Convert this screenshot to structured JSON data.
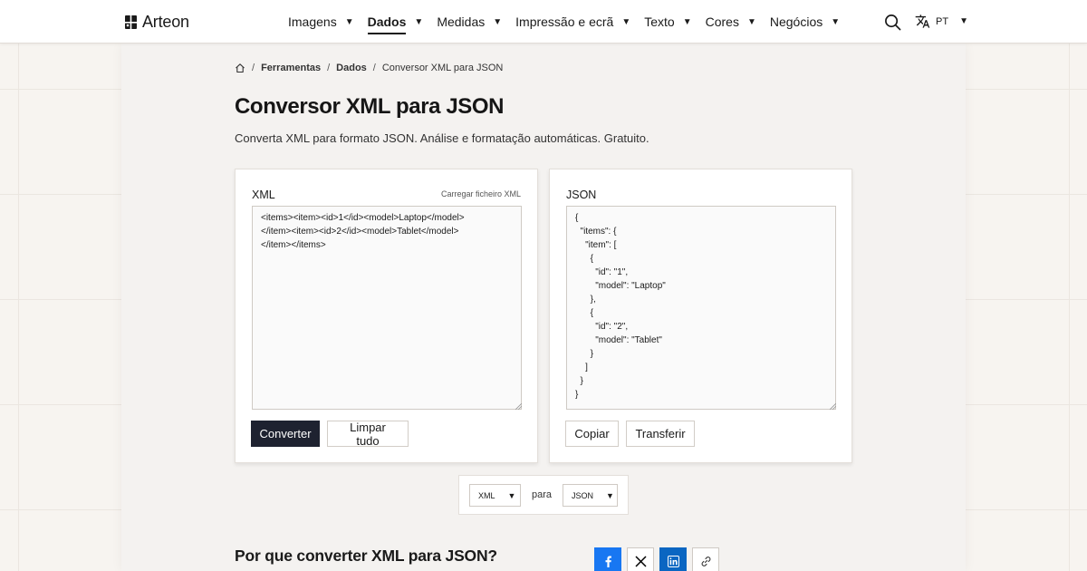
{
  "header": {
    "brand": "Arteon",
    "nav": [
      {
        "label": "Imagens",
        "active": false
      },
      {
        "label": "Dados",
        "active": true
      },
      {
        "label": "Medidas",
        "active": false
      },
      {
        "label": "Impressão e ecrã",
        "active": false
      },
      {
        "label": "Texto",
        "active": false
      },
      {
        "label": "Cores",
        "active": false
      },
      {
        "label": "Negócios",
        "active": false
      }
    ],
    "language": "PT",
    "icons": {
      "search": "search-icon",
      "language": "translate-icon",
      "dropdown": "caret-down-icon"
    }
  },
  "breadcrumb": {
    "items": [
      "Ferramentas",
      "Dados",
      "Conversor XML para JSON"
    ],
    "separator": "/"
  },
  "page": {
    "title": "Conversor XML para JSON",
    "subtitle": "Converta XML para formato JSON. Análise e formatação automáticas. Gratuito."
  },
  "input_panel": {
    "label": "XML",
    "upload_link": "Carregar ficheiro XML",
    "content": "<items><item><id>1</id><model>Laptop</model>\n</item><item><id>2</id><model>Tablet</model>\n</item></items>",
    "convert_button": "Converter",
    "clear_button": "Limpar tudo"
  },
  "output_panel": {
    "label": "JSON",
    "content": "{\n  \"items\": {\n    \"item\": [\n      {\n        \"id\": \"1\",\n        \"model\": \"Laptop\"\n      },\n      {\n        \"id\": \"2\",\n        \"model\": \"Tablet\"\n      }\n    ]\n  }\n}",
    "copy_button": "Copiar",
    "download_button": "Transferir"
  },
  "format_selector": {
    "from": "XML",
    "connector": "para",
    "to": "JSON"
  },
  "section": {
    "title": "Por que converter XML para JSON?"
  },
  "share": [
    {
      "name": "facebook",
      "icon": "facebook-icon",
      "color": "#1877f2"
    },
    {
      "name": "x",
      "icon": "x-icon",
      "color": "#000000"
    },
    {
      "name": "linkedin",
      "icon": "linkedin-icon",
      "color": "#0a66c2"
    },
    {
      "name": "copy-link",
      "icon": "link-icon",
      "color": "#333333"
    }
  ],
  "colors": {
    "primary_button": "#1e2230",
    "page_background": "#f7f4f0",
    "panel_background": "#f4f2f0"
  }
}
